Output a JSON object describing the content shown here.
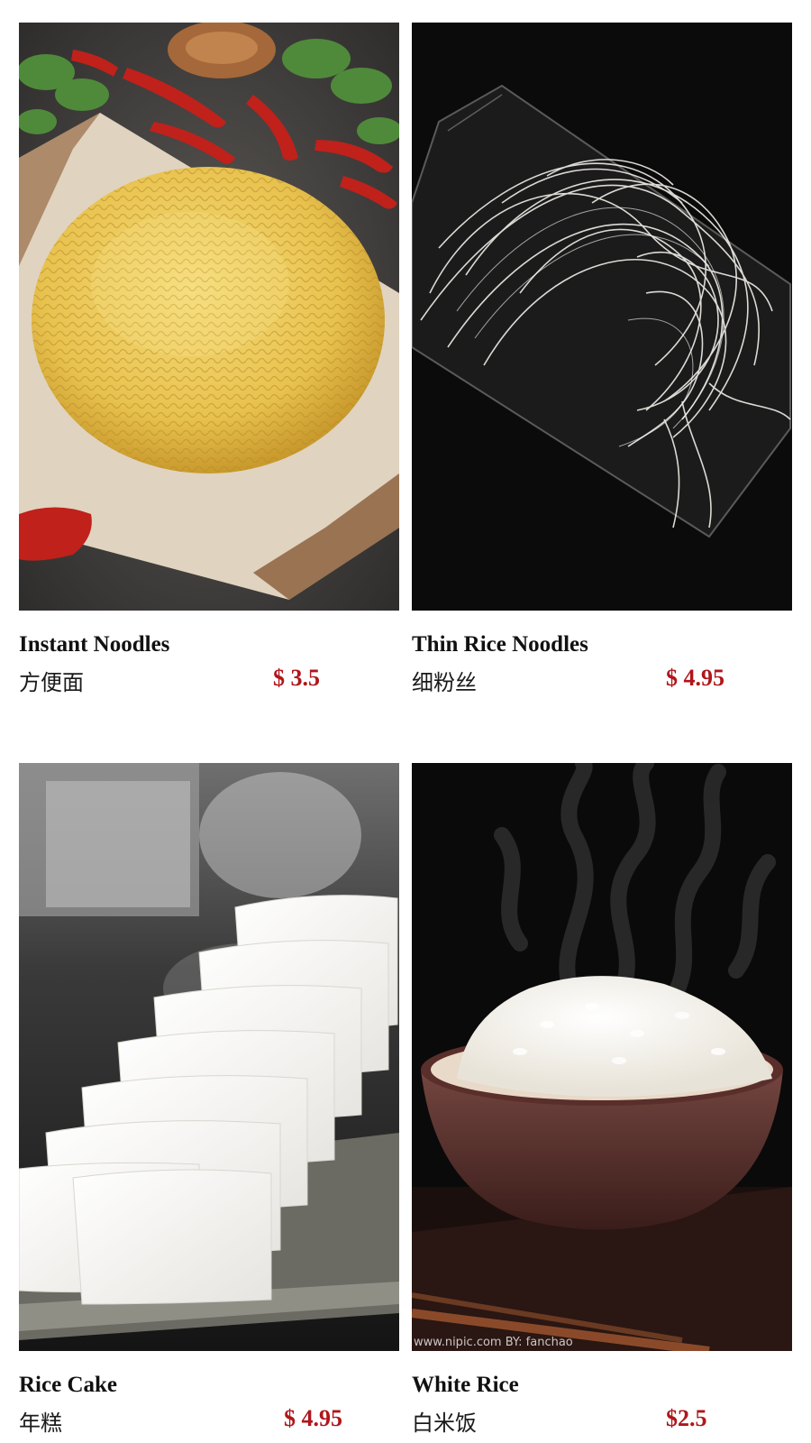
{
  "menu": {
    "items": [
      {
        "name_en": "Instant Noodles",
        "name_cn": "方便面",
        "price": "$ 3.5",
        "image_icon": "instant-noodles-photo"
      },
      {
        "name_en": "Thin Rice Noodles",
        "name_cn": "细粉丝",
        "price": "$ 4.95",
        "image_icon": "thin-rice-noodles-photo"
      },
      {
        "name_en": "Rice Cake",
        "name_cn": "年糕",
        "price": "$ 4.95",
        "image_icon": "rice-cake-photo"
      },
      {
        "name_en": "White Rice",
        "name_cn": "白米饭",
        "price": "$2.5",
        "image_icon": "white-rice-photo",
        "watermark": "www.nipic.com    BY: fanchao"
      }
    ]
  },
  "colors": {
    "price_red": "#b0161b",
    "title_black": "#111111",
    "background": "#ffffff"
  }
}
